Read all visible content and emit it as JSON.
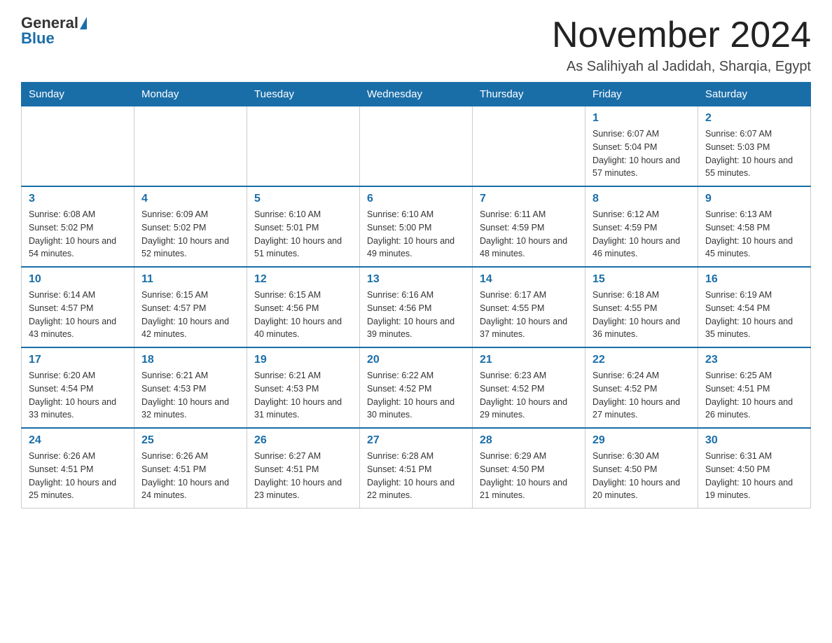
{
  "logo": {
    "general": "General",
    "blue": "Blue"
  },
  "title": "November 2024",
  "location": "As Salihiyah al Jadidah, Sharqia, Egypt",
  "weekdays": [
    "Sunday",
    "Monday",
    "Tuesday",
    "Wednesday",
    "Thursday",
    "Friday",
    "Saturday"
  ],
  "weeks": [
    [
      {
        "day": "",
        "info": ""
      },
      {
        "day": "",
        "info": ""
      },
      {
        "day": "",
        "info": ""
      },
      {
        "day": "",
        "info": ""
      },
      {
        "day": "",
        "info": ""
      },
      {
        "day": "1",
        "info": "Sunrise: 6:07 AM\nSunset: 5:04 PM\nDaylight: 10 hours and 57 minutes."
      },
      {
        "day": "2",
        "info": "Sunrise: 6:07 AM\nSunset: 5:03 PM\nDaylight: 10 hours and 55 minutes."
      }
    ],
    [
      {
        "day": "3",
        "info": "Sunrise: 6:08 AM\nSunset: 5:02 PM\nDaylight: 10 hours and 54 minutes."
      },
      {
        "day": "4",
        "info": "Sunrise: 6:09 AM\nSunset: 5:02 PM\nDaylight: 10 hours and 52 minutes."
      },
      {
        "day": "5",
        "info": "Sunrise: 6:10 AM\nSunset: 5:01 PM\nDaylight: 10 hours and 51 minutes."
      },
      {
        "day": "6",
        "info": "Sunrise: 6:10 AM\nSunset: 5:00 PM\nDaylight: 10 hours and 49 minutes."
      },
      {
        "day": "7",
        "info": "Sunrise: 6:11 AM\nSunset: 4:59 PM\nDaylight: 10 hours and 48 minutes."
      },
      {
        "day": "8",
        "info": "Sunrise: 6:12 AM\nSunset: 4:59 PM\nDaylight: 10 hours and 46 minutes."
      },
      {
        "day": "9",
        "info": "Sunrise: 6:13 AM\nSunset: 4:58 PM\nDaylight: 10 hours and 45 minutes."
      }
    ],
    [
      {
        "day": "10",
        "info": "Sunrise: 6:14 AM\nSunset: 4:57 PM\nDaylight: 10 hours and 43 minutes."
      },
      {
        "day": "11",
        "info": "Sunrise: 6:15 AM\nSunset: 4:57 PM\nDaylight: 10 hours and 42 minutes."
      },
      {
        "day": "12",
        "info": "Sunrise: 6:15 AM\nSunset: 4:56 PM\nDaylight: 10 hours and 40 minutes."
      },
      {
        "day": "13",
        "info": "Sunrise: 6:16 AM\nSunset: 4:56 PM\nDaylight: 10 hours and 39 minutes."
      },
      {
        "day": "14",
        "info": "Sunrise: 6:17 AM\nSunset: 4:55 PM\nDaylight: 10 hours and 37 minutes."
      },
      {
        "day": "15",
        "info": "Sunrise: 6:18 AM\nSunset: 4:55 PM\nDaylight: 10 hours and 36 minutes."
      },
      {
        "day": "16",
        "info": "Sunrise: 6:19 AM\nSunset: 4:54 PM\nDaylight: 10 hours and 35 minutes."
      }
    ],
    [
      {
        "day": "17",
        "info": "Sunrise: 6:20 AM\nSunset: 4:54 PM\nDaylight: 10 hours and 33 minutes."
      },
      {
        "day": "18",
        "info": "Sunrise: 6:21 AM\nSunset: 4:53 PM\nDaylight: 10 hours and 32 minutes."
      },
      {
        "day": "19",
        "info": "Sunrise: 6:21 AM\nSunset: 4:53 PM\nDaylight: 10 hours and 31 minutes."
      },
      {
        "day": "20",
        "info": "Sunrise: 6:22 AM\nSunset: 4:52 PM\nDaylight: 10 hours and 30 minutes."
      },
      {
        "day": "21",
        "info": "Sunrise: 6:23 AM\nSunset: 4:52 PM\nDaylight: 10 hours and 29 minutes."
      },
      {
        "day": "22",
        "info": "Sunrise: 6:24 AM\nSunset: 4:52 PM\nDaylight: 10 hours and 27 minutes."
      },
      {
        "day": "23",
        "info": "Sunrise: 6:25 AM\nSunset: 4:51 PM\nDaylight: 10 hours and 26 minutes."
      }
    ],
    [
      {
        "day": "24",
        "info": "Sunrise: 6:26 AM\nSunset: 4:51 PM\nDaylight: 10 hours and 25 minutes."
      },
      {
        "day": "25",
        "info": "Sunrise: 6:26 AM\nSunset: 4:51 PM\nDaylight: 10 hours and 24 minutes."
      },
      {
        "day": "26",
        "info": "Sunrise: 6:27 AM\nSunset: 4:51 PM\nDaylight: 10 hours and 23 minutes."
      },
      {
        "day": "27",
        "info": "Sunrise: 6:28 AM\nSunset: 4:51 PM\nDaylight: 10 hours and 22 minutes."
      },
      {
        "day": "28",
        "info": "Sunrise: 6:29 AM\nSunset: 4:50 PM\nDaylight: 10 hours and 21 minutes."
      },
      {
        "day": "29",
        "info": "Sunrise: 6:30 AM\nSunset: 4:50 PM\nDaylight: 10 hours and 20 minutes."
      },
      {
        "day": "30",
        "info": "Sunrise: 6:31 AM\nSunset: 4:50 PM\nDaylight: 10 hours and 19 minutes."
      }
    ]
  ]
}
